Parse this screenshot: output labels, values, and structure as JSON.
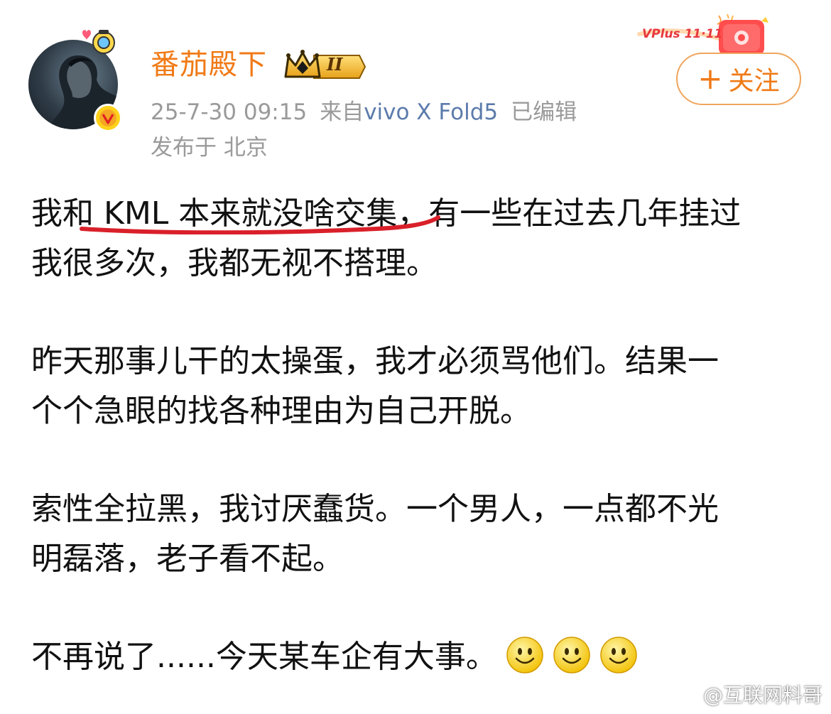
{
  "post": {
    "author": {
      "name": "番茄殿下",
      "level_badge": "II"
    },
    "meta": {
      "time": "25-7-30 09:15",
      "source_prefix": "来自",
      "source": "vivo X Fold5",
      "edited": "已编辑",
      "location": "发布于 北京"
    },
    "follow_label": "关注",
    "promo_banner": "VPlus 11·11",
    "paragraphs": [
      {
        "lines": [
          "我和 KML 本来就没啥交集，有一些在过去几年挂过",
          "我很多次，我都无视不搭理。"
        ]
      },
      {
        "lines": [
          "昨天那事儿干的太操蛋，我才必须骂他们。结果一",
          "个个急眼的找各种理由为自己开脱。"
        ]
      },
      {
        "lines": [
          "索性全拉黑，我讨厌蠢货。一个男人，一点都不光",
          "明磊落，老子看不起。"
        ]
      },
      {
        "lines": [
          "不再说了......今天某车企有大事。"
        ]
      }
    ],
    "emojis": [
      "smile-emoji",
      "smile-emoji",
      "smile-emoji"
    ]
  },
  "watermark": "@互联网料哥",
  "colors": {
    "username": "#f07a16",
    "meta_gray": "#9a9a9a",
    "source_link": "#5b7bab",
    "underline": "#d9202a",
    "follow_border": "#f0a55c"
  }
}
